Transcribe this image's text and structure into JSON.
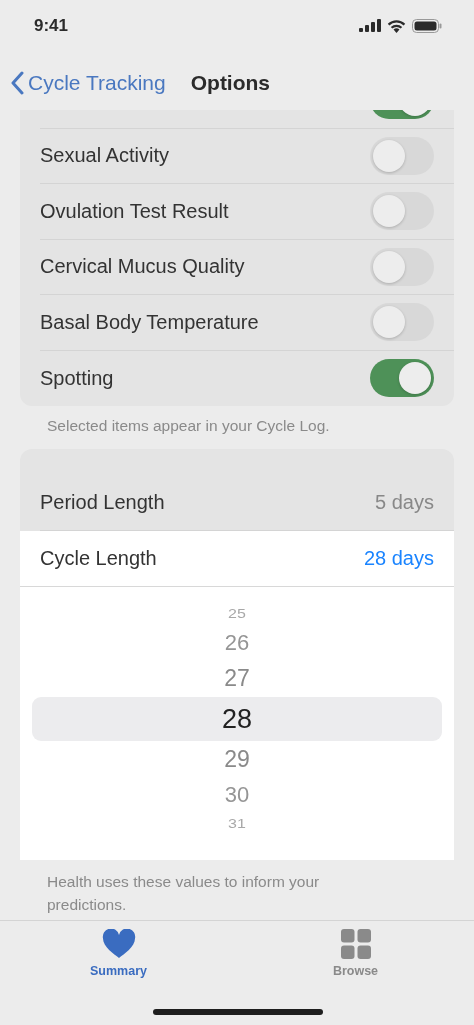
{
  "status_bar": {
    "time": "9:41"
  },
  "nav": {
    "back": "Cycle Tracking",
    "title": "Options"
  },
  "log_options": {
    "rows": [
      {
        "on": true
      },
      {
        "label": "Sexual Activity",
        "on": false
      },
      {
        "label": "Ovulation Test Result",
        "on": false
      },
      {
        "label": "Cervical Mucus Quality",
        "on": false
      },
      {
        "label": "Basal Body Temperature",
        "on": false
      },
      {
        "label": "Spotting",
        "on": true
      }
    ],
    "footer": "Selected items appear in your Cycle Log."
  },
  "cycle_settings": {
    "rows": [
      {
        "label": "Period Length",
        "value": "5 days",
        "expanded": false
      },
      {
        "label": "Cycle Length",
        "value": "28 days",
        "expanded": true,
        "picker": [
          {
            "value": "25",
            "selected": false
          },
          {
            "value": "26",
            "selected": false
          },
          {
            "value": "27",
            "selected": false
          },
          {
            "value": "28",
            "selected": true
          },
          {
            "value": "29",
            "selected": false
          },
          {
            "value": "30",
            "selected": false
          },
          {
            "value": "31",
            "selected": false
          }
        ]
      }
    ],
    "footer": "Health uses these values to inform your predictions."
  },
  "tab_bar": [
    {
      "label": "Summary",
      "kind": "heart",
      "selected": true
    },
    {
      "label": "Browse",
      "kind": "grid",
      "selected": false
    }
  ]
}
